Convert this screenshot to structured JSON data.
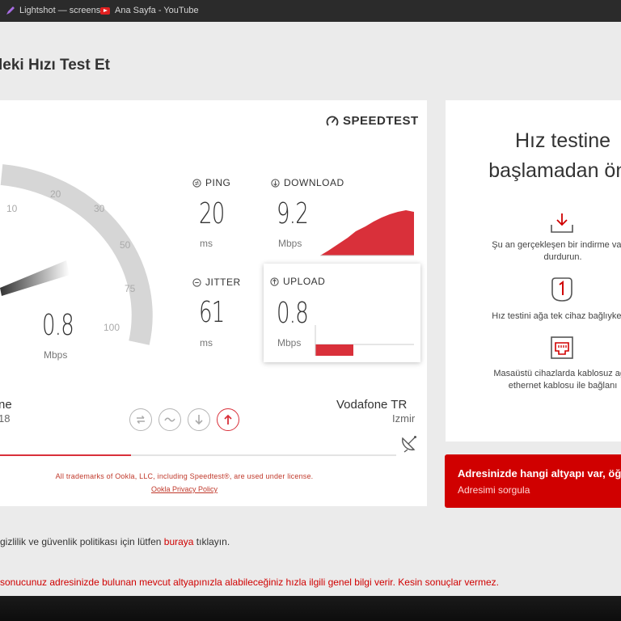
{
  "bookmarks": [
    {
      "label": "Lightshot — screens...",
      "icon": "lightshot-feather-icon"
    },
    {
      "label": "Ana Sayfa - YouTube",
      "icon": "youtube-icon"
    }
  ],
  "page": {
    "title": "leki Hızı Test Et"
  },
  "speedtest": {
    "logo": "SPEEDTEST",
    "gauge": {
      "ticks": [
        "10",
        "20",
        "30",
        "50",
        "75",
        "100"
      ],
      "value": "0.8",
      "unit": "Mbps",
      "needle_value": 0.8
    },
    "ping": {
      "label": "PING",
      "value": "20",
      "unit": "ms"
    },
    "download": {
      "label": "DOWNLOAD",
      "value": "9.2",
      "unit": "Mbps"
    },
    "jitter": {
      "label": "JITTER",
      "value": "61",
      "unit": "ms"
    },
    "upload": {
      "label": "UPLOAD",
      "value": "0.8",
      "unit": "Mbps"
    },
    "client": {
      "name": "ne",
      "sub": "18"
    },
    "server": {
      "name": "Vodafone TR",
      "city": "Izmir"
    },
    "progress_fraction": 0.33,
    "trademark": "All trademarks of Ookla, LLC, including Speedtest®, are used under license.",
    "privacy": "Ookla Privacy Policy",
    "accent": "#d9303a"
  },
  "info": {
    "title_line1": "Hız testine",
    "title_line2": "başlamadan önc",
    "tips": [
      {
        "icon": "download-tray-icon",
        "line1": "Şu an gerçekleşen bir indirme varsa",
        "line2": "durdurun."
      },
      {
        "icon": "number-one-icon",
        "line1": "Hız testini ağa tek cihaz bağlıyken b",
        "line2": ""
      },
      {
        "icon": "ethernet-port-icon",
        "line1": "Masaüstü cihazlarda kablosuz ağ y",
        "line2": "ethernet kablosu ile bağlanı"
      }
    ]
  },
  "banner": {
    "title": "Adresinizde hangi altyapı var, öğre",
    "subtitle": "Adresimi sorgula",
    "color": "#d00000"
  },
  "footer": {
    "privacy_pre": "gizlilik ve güvenlik politikası için lütfen ",
    "privacy_link": "buraya",
    "privacy_post": " tıklayın.",
    "disclaimer": "sonucunuz adresinizde bulunan mevcut altyapınızla alabileceğiniz hızla ilgili genel bilgi verir. Kesin sonuçlar vermez."
  }
}
